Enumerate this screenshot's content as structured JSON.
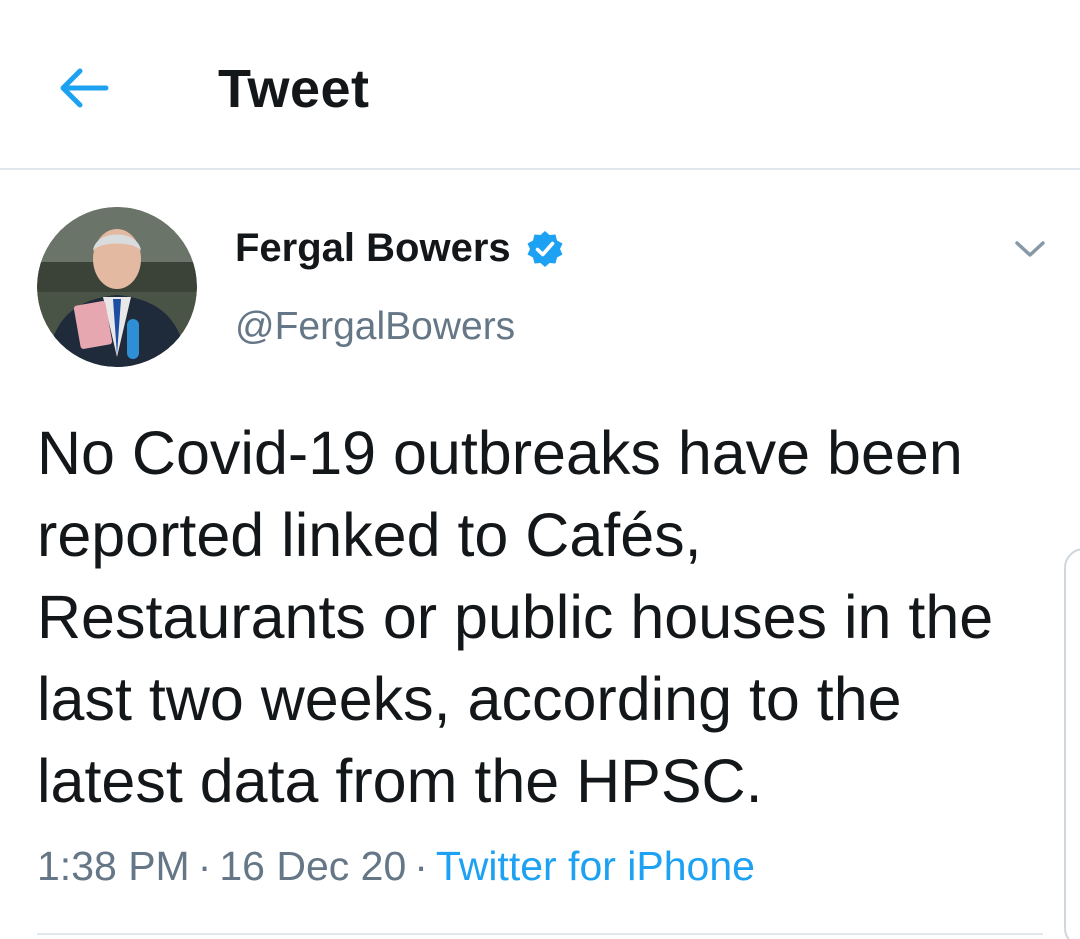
{
  "header": {
    "title": "Tweet",
    "back_icon": "arrow-left-icon"
  },
  "tweet": {
    "author": {
      "name": "Fergal Bowers",
      "handle": "@FergalBowers",
      "verified": true,
      "avatar_icon": "avatar-photo"
    },
    "text": "No Covid-19 outbreaks have been reported linked to Cafés, Restaurants or public houses in the last two weeks, according to the latest data from the HPSC.",
    "time": "1:38 PM",
    "date": "16 Dec 20",
    "separator": "·",
    "source": "Twitter for iPhone",
    "menu_icon": "chevron-down-icon"
  },
  "colors": {
    "accent": "#1da1f2",
    "text_primary": "#14171a",
    "text_secondary": "#657786",
    "divider": "#e1e8ed"
  }
}
